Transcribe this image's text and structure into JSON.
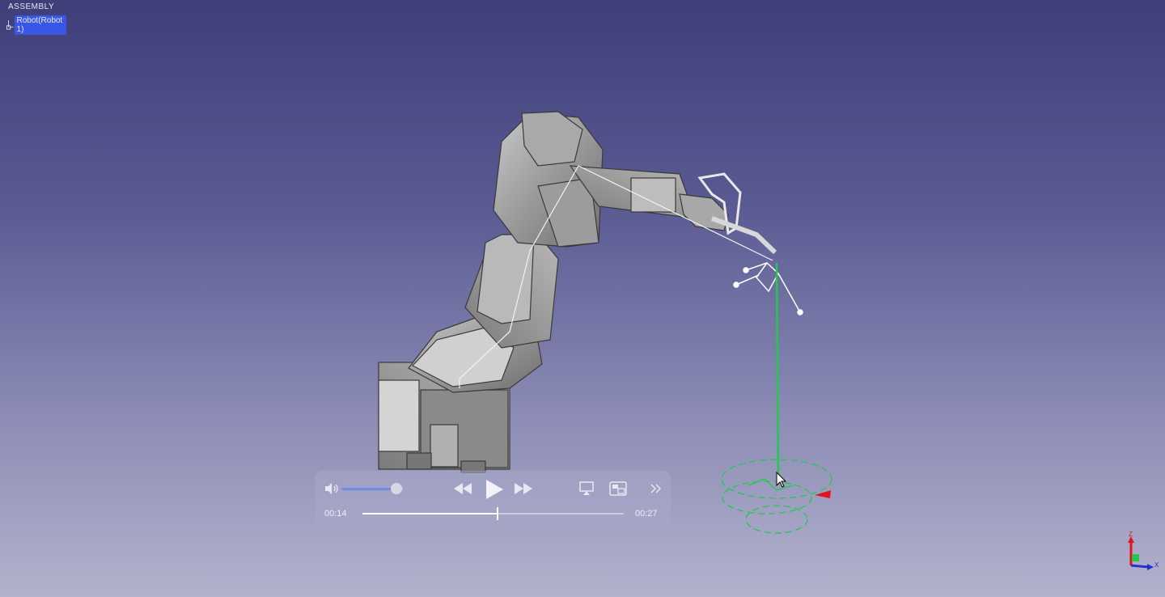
{
  "tree": {
    "title": "ASSEMBLY",
    "node_label": "Robot(Robot 1)"
  },
  "player": {
    "current_time": "00:14",
    "duration": "00:27",
    "progress": 0.5185,
    "volume": 0.9
  },
  "axis": {
    "z_label": "Z",
    "x_label": "X"
  },
  "colors": {
    "selection": "#3a56e8",
    "trajectory": "#22c94a",
    "volume_fill": "#6b8fe6"
  }
}
